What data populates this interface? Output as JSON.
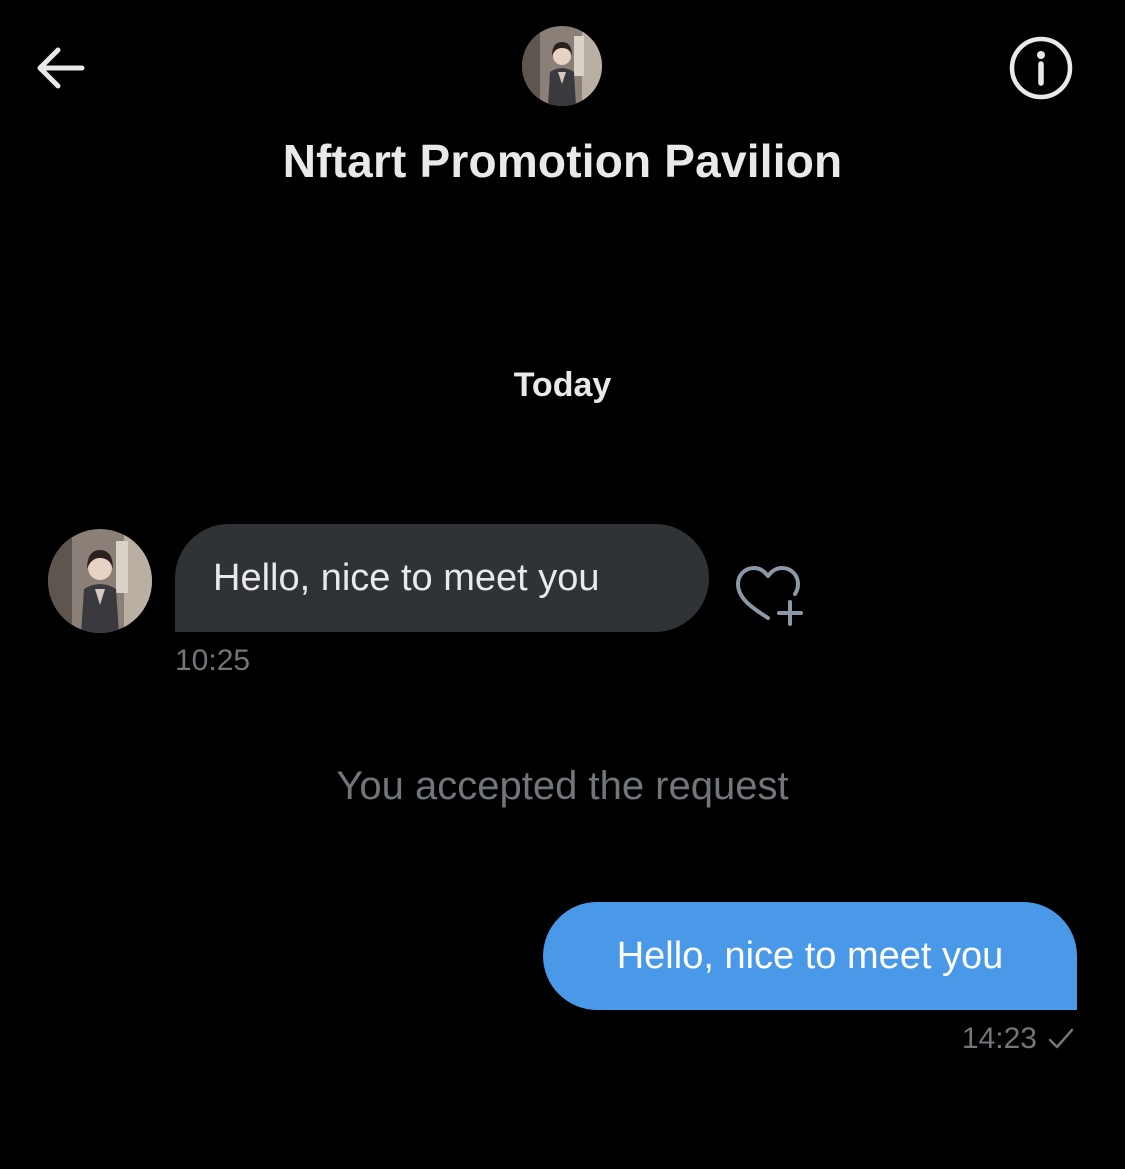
{
  "header": {
    "title": "Nftart Promotion Pavilion",
    "back_icon": "arrow-left-icon",
    "info_icon": "info-circle-icon"
  },
  "conversation": {
    "date_separator": "Today",
    "messages": [
      {
        "direction": "incoming",
        "text": "Hello, nice to meet you",
        "time": "10:25",
        "reaction_icon": "heart-plus-icon"
      },
      {
        "direction": "outgoing",
        "text": "Hello, nice to meet you",
        "time": "14:23",
        "status_icon": "checkmark-icon"
      }
    ],
    "system_notice": "You accepted the request"
  },
  "colors": {
    "background": "#000000",
    "incoming_bubble": "#2f3336",
    "outgoing_bubble": "#4a99e9",
    "primary_text": "#e7e9ea",
    "secondary_text": "#71767b"
  }
}
